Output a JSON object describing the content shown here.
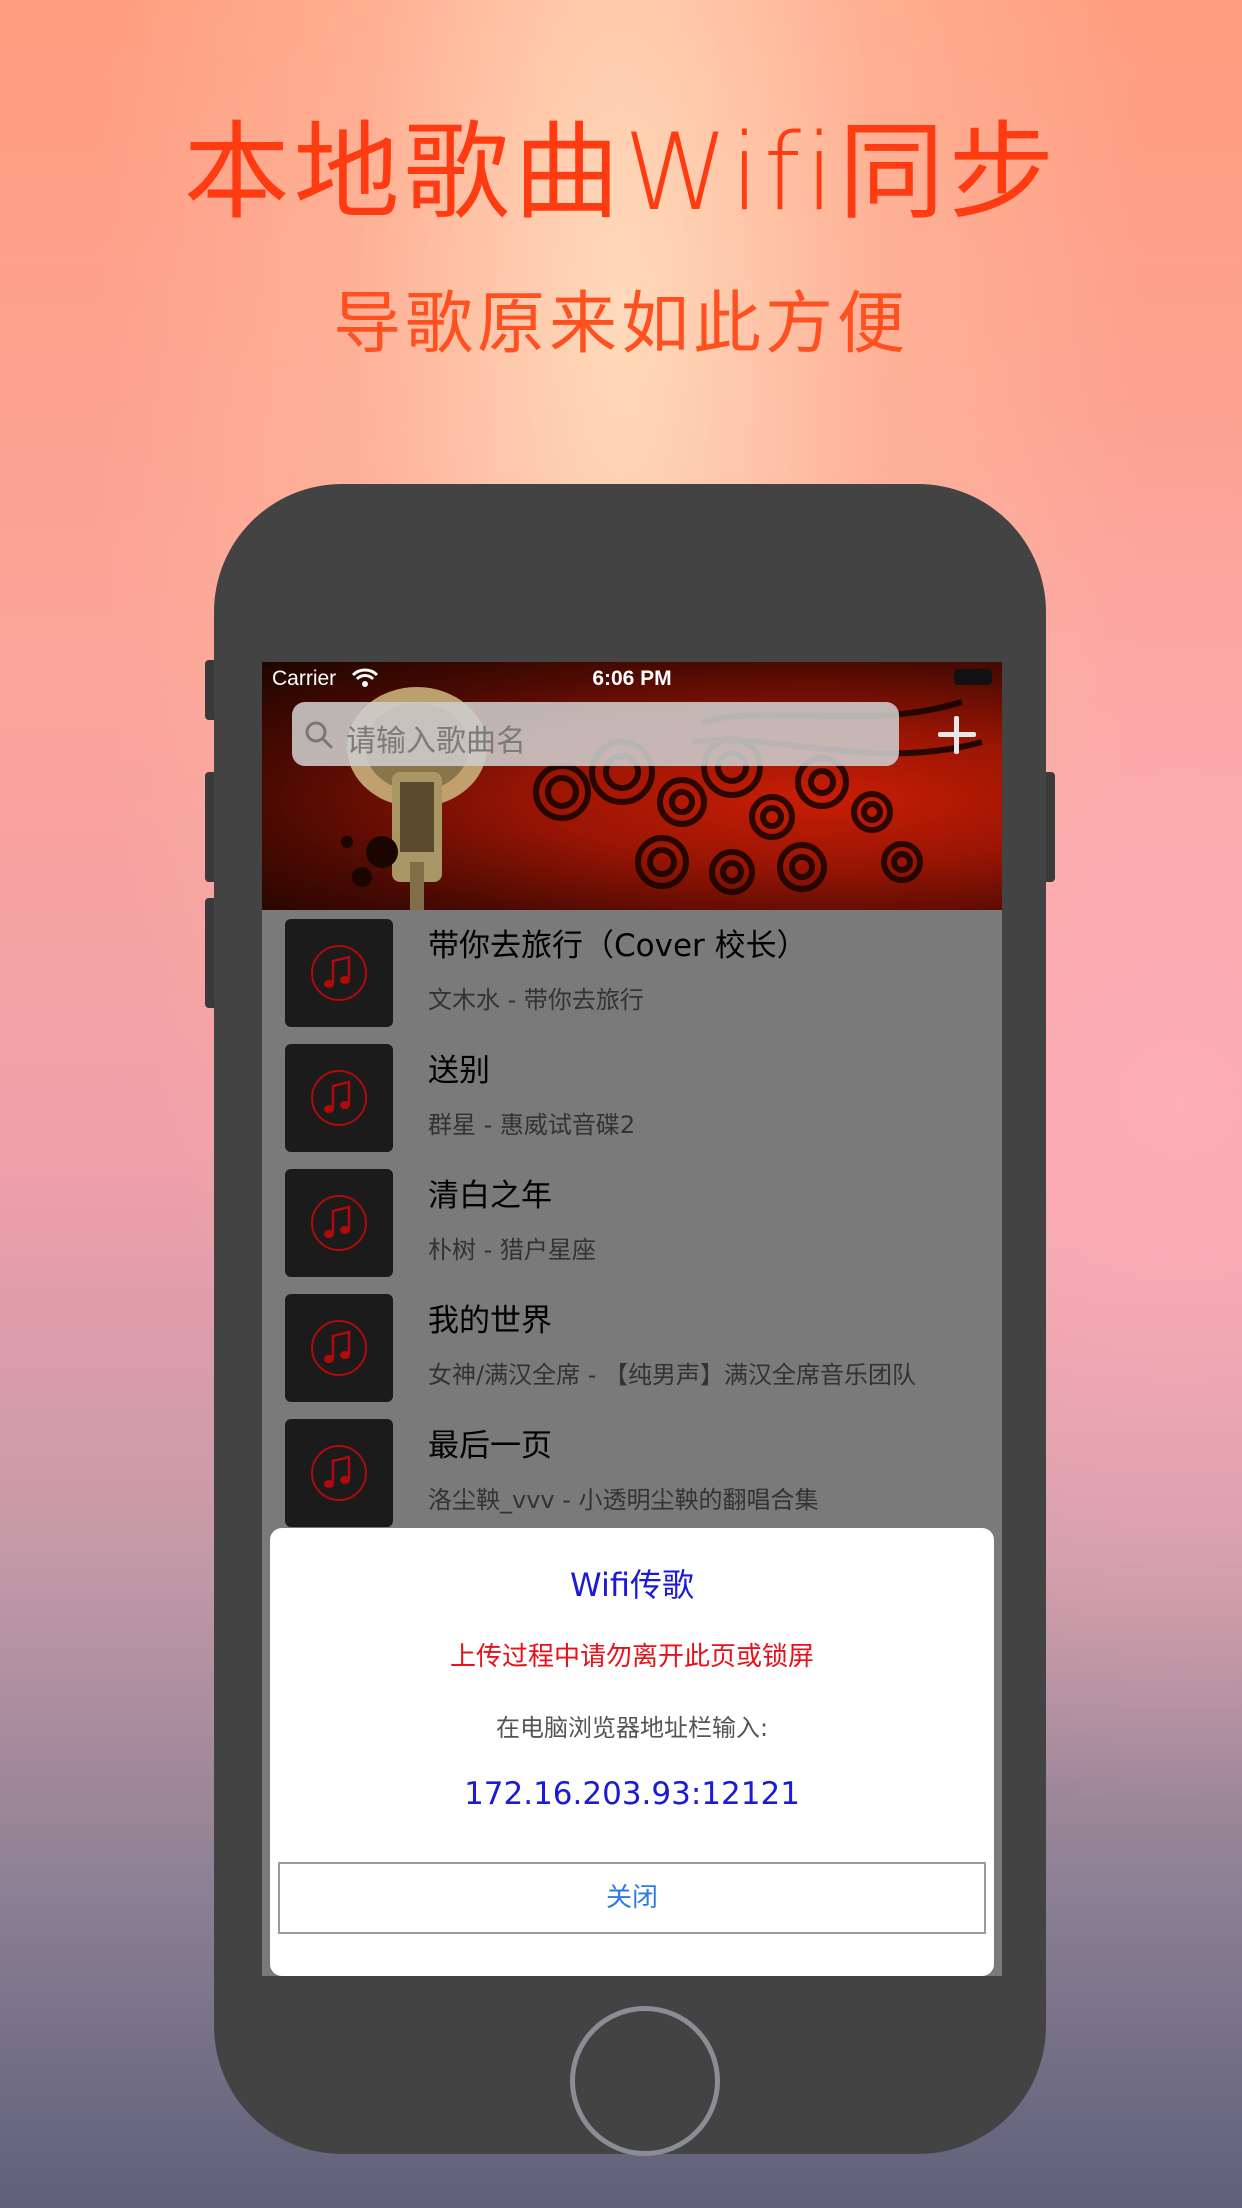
{
  "promo": {
    "title": "本地歌曲Wifi同步",
    "subtitle": "导歌原来如此方便"
  },
  "statusbar": {
    "carrier": "Carrier",
    "time": "6:06 PM"
  },
  "search": {
    "placeholder": "请输入歌曲名"
  },
  "songs": [
    {
      "title": "带你去旅行（Cover 校长）",
      "subtitle": "文木水 - 带你去旅行"
    },
    {
      "title": "送别",
      "subtitle": "群星 - 惠威试音碟2"
    },
    {
      "title": "清白之年",
      "subtitle": "朴树 - 猎户星座"
    },
    {
      "title": "我的世界",
      "subtitle": "女神/满汉全席 - 【纯男声】满汉全席音乐团队"
    },
    {
      "title": "最后一页",
      "subtitle": "洛尘鞅_vvv - 小透明尘鞅的翻唱合集"
    }
  ],
  "dialog": {
    "title": "Wifi传歌",
    "warning": "上传过程中请勿离开此页或锁屏",
    "instruction": "在电脑浏览器地址栏输入:",
    "address": "172.16.203.93:12121",
    "close_label": "关闭"
  },
  "colors": {
    "promo_title": "#ff3b12",
    "dialog_title": "#1a1ad8",
    "dialog_warning": "#e8101a",
    "close_button_text": "#2d7ae6",
    "phone_body": "#434343"
  },
  "icons": {
    "search": "search-icon",
    "add": "plus-icon",
    "cover": "music-note-icon",
    "wifi": "wifi-icon",
    "battery": "battery-icon"
  }
}
